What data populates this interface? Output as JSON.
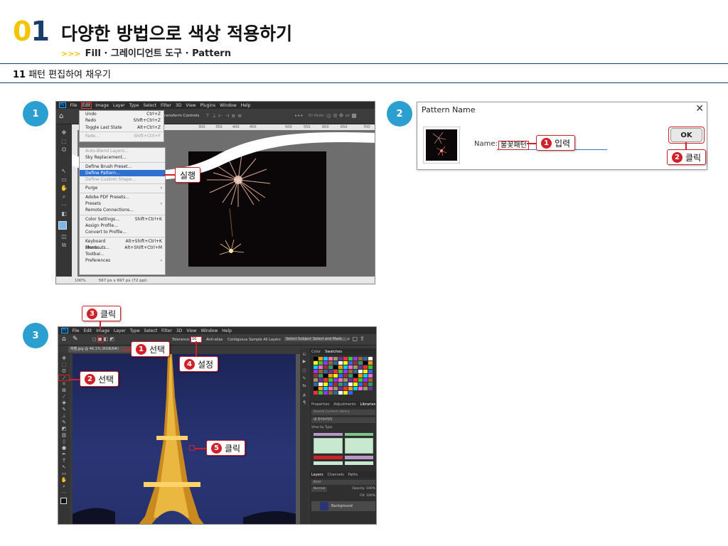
{
  "header": {
    "chapter_zero": "0",
    "chapter_one": "1",
    "title": "다양한 방법으로 색상 적용하기",
    "subtitle_arrows": ">>>",
    "subtitle": "Fill · 그레이디언트 도구 · Pattern"
  },
  "section": {
    "number": "11",
    "title": "패턴 편집하여 채우기"
  },
  "steps": [
    "1",
    "2",
    "3"
  ],
  "step1": {
    "menubar": [
      "Ps",
      "File",
      "Edit",
      "Image",
      "Layer",
      "Type",
      "Select",
      "Filter",
      "3D",
      "View",
      "Plugins",
      "Window",
      "Help"
    ],
    "options_label": "ransform Controls",
    "options_right": "3D Mode:",
    "ruler_ticks": [
      "300",
      "350",
      "400",
      "450",
      "500",
      "550",
      "600",
      "650",
      "700"
    ],
    "edit_menu": [
      {
        "label": "Undo",
        "shortcut": "Ctrl+Z",
        "state": "normal"
      },
      {
        "label": "Redo",
        "shortcut": "Shift+Ctrl+Z",
        "state": "normal"
      },
      {
        "label": "Toggle Last State",
        "shortcut": "Alt+Ctrl+Z",
        "state": "normal"
      },
      {
        "sep": true
      },
      {
        "label": "Fade...",
        "shortcut": "Shift+Ctrl+F",
        "state": "disabled"
      }
    ],
    "edit_menu_lower": [
      {
        "label": "Auto-Blend Layers...",
        "shortcut": "",
        "state": "disabled"
      },
      {
        "label": "Sky Replacement...",
        "shortcut": "",
        "state": "normal"
      },
      {
        "sep": true
      },
      {
        "label": "Define Brush Preset...",
        "shortcut": "",
        "state": "normal"
      },
      {
        "label": "Define Pattern...",
        "shortcut": "",
        "state": "selected"
      },
      {
        "label": "Define Custom Shape...",
        "shortcut": "",
        "state": "disabled"
      },
      {
        "sep": true
      },
      {
        "label": "Purge",
        "shortcut": "›",
        "state": "normal"
      },
      {
        "sep": true
      },
      {
        "label": "Adobe PDF Presets...",
        "shortcut": "",
        "state": "normal"
      },
      {
        "label": "Presets",
        "shortcut": "›",
        "state": "normal"
      },
      {
        "label": "Remote Connections...",
        "shortcut": "",
        "state": "normal"
      },
      {
        "sep": true
      },
      {
        "label": "Color Settings...",
        "shortcut": "Shift+Ctrl+K",
        "state": "normal"
      },
      {
        "label": "Assign Profile...",
        "shortcut": "",
        "state": "normal"
      },
      {
        "label": "Convert to Profile...",
        "shortcut": "",
        "state": "normal"
      },
      {
        "sep": true
      },
      {
        "label": "Keyboard Shortcuts...",
        "shortcut": "Alt+Shift+Ctrl+K",
        "state": "normal"
      },
      {
        "label": "Menus...",
        "shortcut": "Alt+Shift+Ctrl+M",
        "state": "normal"
      },
      {
        "label": "Toolbar...",
        "shortcut": "",
        "state": "normal"
      },
      {
        "label": "Preferences",
        "shortcut": "›",
        "state": "normal"
      }
    ],
    "callout": "실행",
    "statusbar": {
      "zoom": "100%",
      "size": "567 px x 697 px (72 ppi)"
    }
  },
  "step2": {
    "dialog_title": "Pattern Name",
    "close_glyph": "✕",
    "name_label": "Name:",
    "name_value": "불꽃패턴",
    "ok_label": "OK",
    "callout_input": {
      "num": "1",
      "text": "입력"
    },
    "callout_click": {
      "num": "2",
      "text": "클릭"
    }
  },
  "step3": {
    "menubar": [
      "Ps",
      "File",
      "Edit",
      "Image",
      "Layer",
      "Type",
      "Select",
      "Filter",
      "3D",
      "View",
      "Window",
      "Help"
    ],
    "doc_tab": "에펠.jpg @ 46.1% (RGB/8#)",
    "tolerance_label": "Tolerance:",
    "tolerance_value": "10",
    "options": [
      "Anti-alias",
      "Contiguous",
      "Sample All Layers"
    ],
    "buttons": [
      "Select Subject",
      "Select and Mask..."
    ],
    "panel_tabs_top": [
      "Color",
      "Swatches"
    ],
    "panel_tabs_mid": [
      "Properties",
      "Adjustments",
      "Libraries"
    ],
    "library_search": "Search Current Library",
    "library_name": "내 라이브러리",
    "view_by": "View by Type",
    "panel_tabs_bottom": [
      "Layers",
      "Channels",
      "Paths"
    ],
    "layers_kind": "Kind",
    "layers_mode": "Normal",
    "layers_opacity": "Opacity: 100%",
    "layers_fill": "Fill: 100%",
    "layer_name": "Background",
    "callouts": [
      {
        "num": "3",
        "text": "클릭"
      },
      {
        "num": "1",
        "text": "선택"
      },
      {
        "num": "4",
        "text": "설정"
      },
      {
        "num": "2",
        "text": "선택"
      },
      {
        "num": "5",
        "text": "클릭"
      }
    ]
  }
}
